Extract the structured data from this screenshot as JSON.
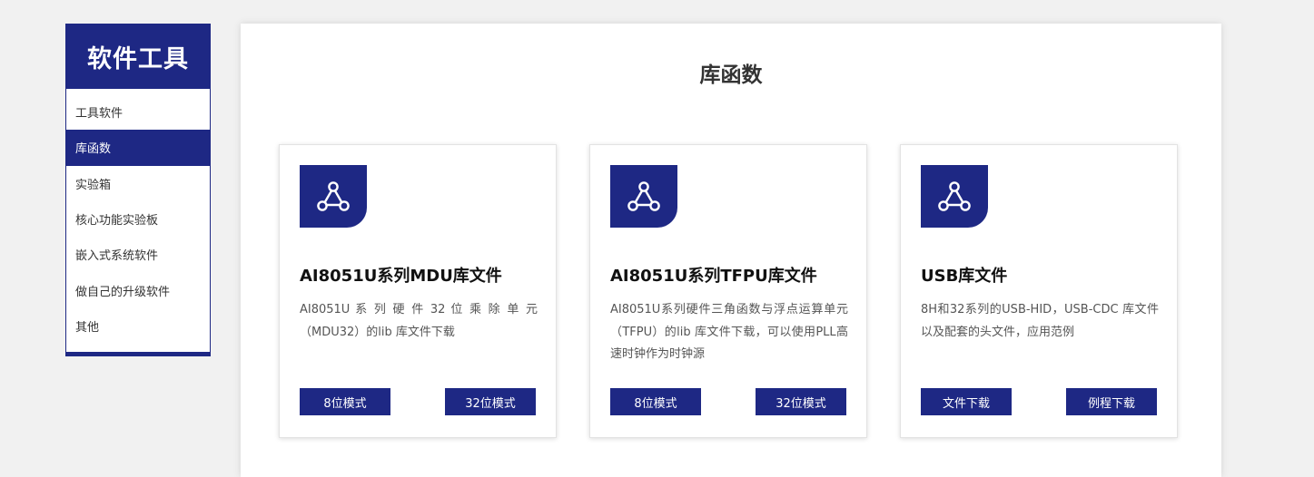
{
  "sidebar": {
    "title": "软件工具",
    "items": [
      {
        "label": "工具软件",
        "active": false
      },
      {
        "label": "库函数",
        "active": true
      },
      {
        "label": "实验箱",
        "active": false
      },
      {
        "label": "核心功能实验板",
        "active": false
      },
      {
        "label": "嵌入式系统软件",
        "active": false
      },
      {
        "label": "做自己的升级软件",
        "active": false
      },
      {
        "label": "其他",
        "active": false
      }
    ]
  },
  "main": {
    "title": "库函数",
    "cards": [
      {
        "icon": "share-nodes-icon",
        "title": "AI8051U系列MDU库文件",
        "description": "AI8051U 系 列 硬 件 32 位 乘 除 单 元（MDU32）的lib 库文件下载",
        "buttons": [
          "8位模式",
          "32位模式"
        ]
      },
      {
        "icon": "share-nodes-icon",
        "title": "AI8051U系列TFPU库文件",
        "description": "AI8051U系列硬件三角函数与浮点运算单元（TFPU）的lib 库文件下载，可以使用PLL高速时钟作为时钟源",
        "buttons": [
          "8位模式",
          "32位模式"
        ]
      },
      {
        "icon": "share-nodes-icon",
        "title": "USB库文件",
        "description": "8H和32系列的USB-HID，USB-CDC 库文件以及配套的头文件，应用范例",
        "buttons": [
          "文件下载",
          "例程下载"
        ]
      }
    ]
  },
  "colors": {
    "brand": "#1e2884",
    "page_bg": "#f1f1f1",
    "card_bg": "#ffffff"
  }
}
